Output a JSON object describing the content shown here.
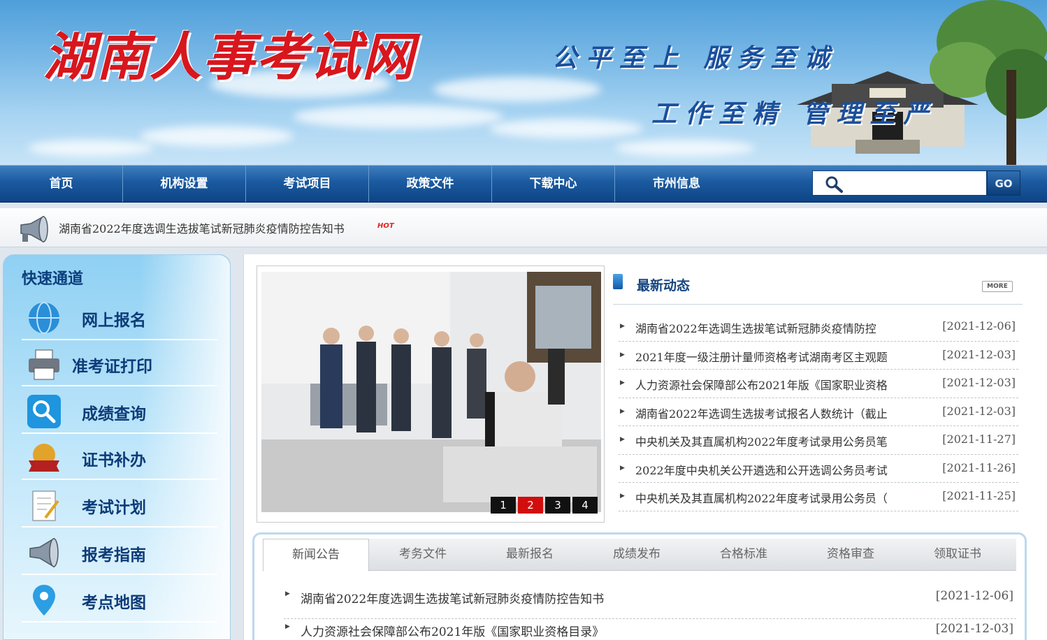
{
  "banner": {
    "title": "湖南人事考试网",
    "slogan_1": "公平至上 服务至诚",
    "slogan_2": "工作至精 管理至严"
  },
  "nav": {
    "items": [
      "首页",
      "机构设置",
      "考试项目",
      "政策文件",
      "下载中心",
      "市州信息"
    ],
    "search_placeholder": "",
    "go_label": "GO"
  },
  "notice": {
    "text": "湖南省2022年度选调生选拔笔试新冠肺炎疫情防控告知书",
    "badge": "HOT"
  },
  "quick_access": {
    "title": "快速通道",
    "items": [
      {
        "label": "网上报名",
        "icon": "globe-icon"
      },
      {
        "label": "准考证打印",
        "icon": "printer-icon"
      },
      {
        "label": "成绩查询",
        "icon": "magnifier-icon"
      },
      {
        "label": "证书补办",
        "icon": "certificate-icon"
      },
      {
        "label": "考试计划",
        "icon": "notepad-icon"
      },
      {
        "label": "报考指南",
        "icon": "megaphone-icon"
      },
      {
        "label": "考点地图",
        "icon": "map-pin-icon"
      }
    ]
  },
  "slideshow": {
    "pages": [
      "1",
      "2",
      "3",
      "4"
    ],
    "active_page": "2"
  },
  "latest_news": {
    "title": "最新动态",
    "more_label": "MORE",
    "items": [
      {
        "text": "湖南省2022年选调生选拔笔试新冠肺炎疫情防控",
        "date": "[2021-12-06]"
      },
      {
        "text": "2021年度一级注册计量师资格考试湖南考区主观题",
        "date": "[2021-12-03]"
      },
      {
        "text": "人力资源社会保障部公布2021年版《国家职业资格",
        "date": "[2021-12-03]"
      },
      {
        "text": "湖南省2022年选调生选拔考试报名人数统计（截止",
        "date": "[2021-12-03]"
      },
      {
        "text": "中央机关及其直属机构2022年度考试录用公务员笔",
        "date": "[2021-11-27]"
      },
      {
        "text": "2022年度中央机关公开遴选和公开选调公务员考试",
        "date": "[2021-11-26]"
      },
      {
        "text": "中央机关及其直属机构2022年度考试录用公务员（",
        "date": "[2021-11-25]"
      }
    ]
  },
  "tabs": {
    "labels": [
      "新闻公告",
      "考务文件",
      "最新报名",
      "成绩发布",
      "合格标准",
      "资格审查",
      "领取证书"
    ],
    "active": "新闻公告",
    "items": [
      {
        "text": "湖南省2022年度选调生选拔笔试新冠肺炎疫情防控告知书",
        "date": "[2021-12-06]"
      },
      {
        "text": "人力资源社会保障部公布2021年版《国家职业资格目录》",
        "date": "[2021-12-03]"
      }
    ]
  },
  "colors": {
    "nav_blue": "#1b5aa0",
    "title_red": "#d8161d",
    "active_slide": "#d20d0d",
    "heading_blue": "#16457f"
  }
}
